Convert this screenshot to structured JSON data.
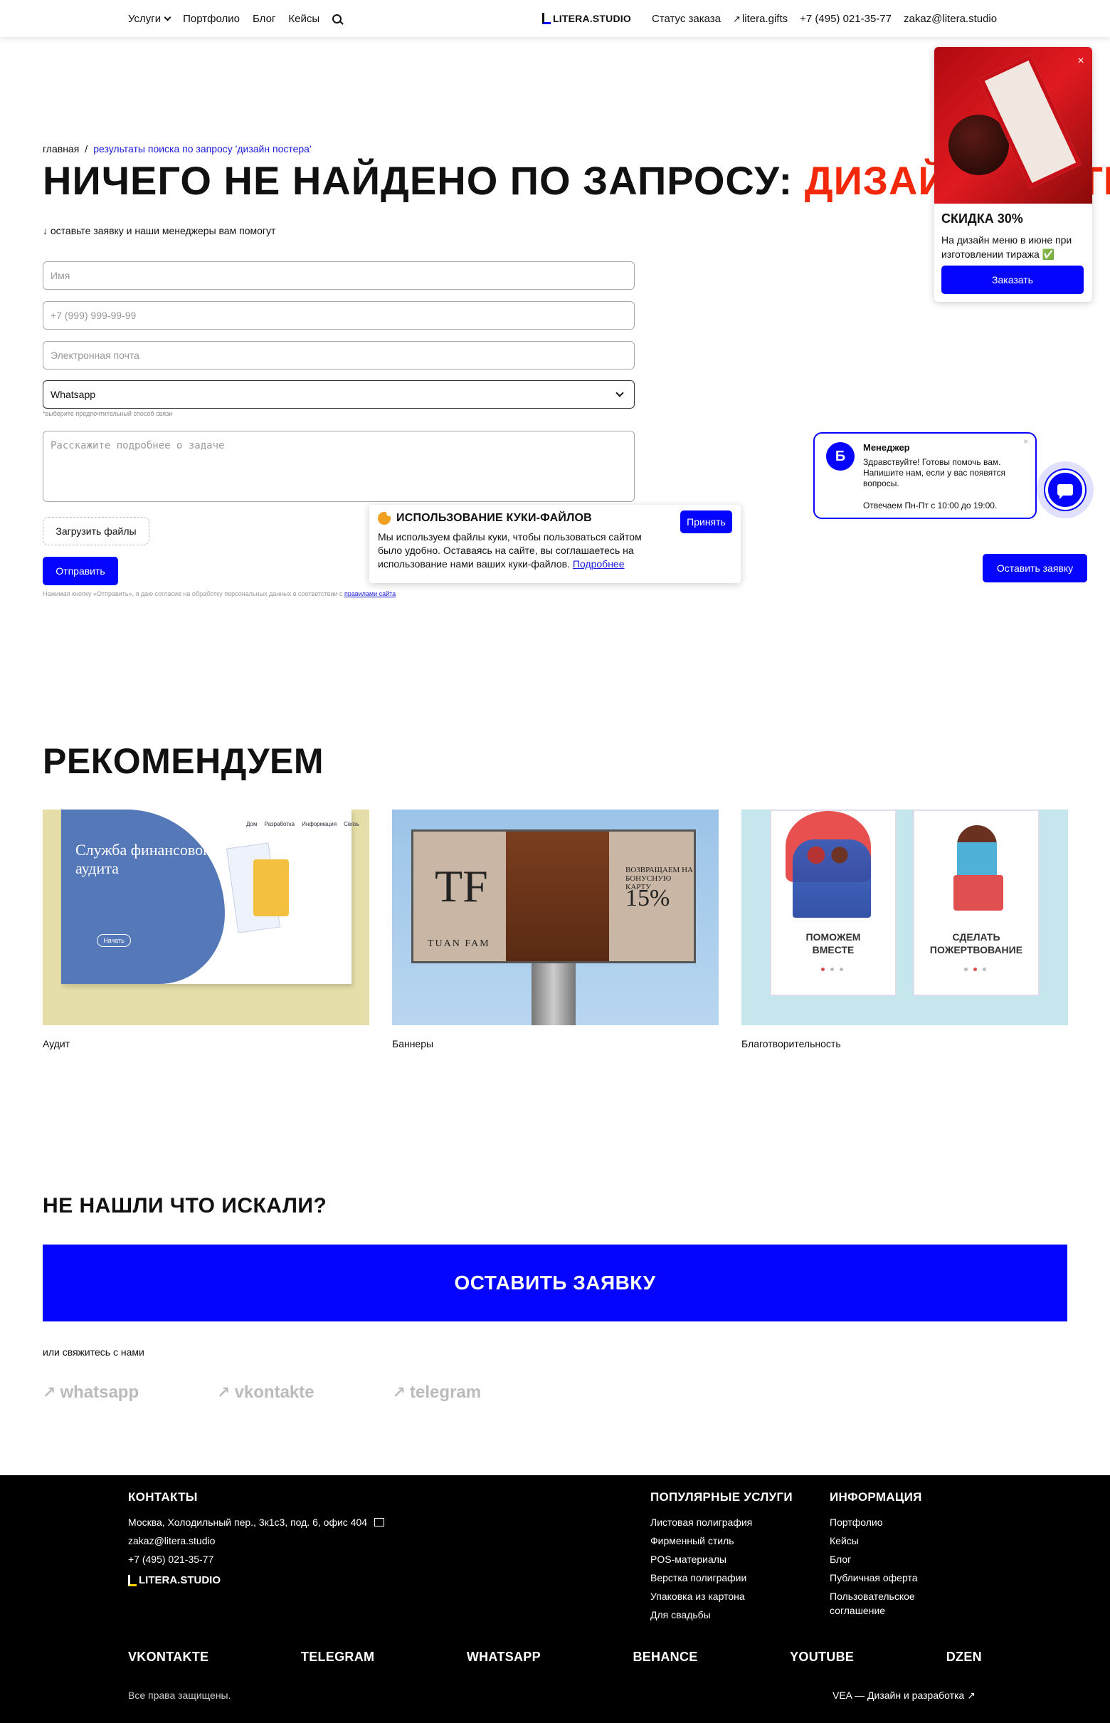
{
  "header": {
    "nav": [
      "Услуги",
      "Портфолио",
      "Блог",
      "Кейсы"
    ],
    "logo": "LITERA.STUDIO",
    "order_status": "Статус заказа",
    "gifts": "litera.gifts",
    "phone": "+7 (495) 021-35-77",
    "email": "zakaz@litera.studio"
  },
  "breadcrumb": {
    "home": "главная",
    "sep": "/",
    "current": "результаты поиска по запросу 'дизайн постера'"
  },
  "title": {
    "prefix": "НИЧЕГО НЕ НАЙДЕНО ПО ЗАПРОСУ:",
    "query": "ДИЗАЙН ПОСТЕРА"
  },
  "hint": "↓ оставьте заявку и наши менеджеры вам помогут",
  "form": {
    "name_placeholder": "Имя",
    "phone_placeholder": "+7 (999) 999-99-99",
    "email_placeholder": "Электронная почта",
    "contact_method": "Whatsapp",
    "contact_note": "*выберите предпочтительный способ связи",
    "message_placeholder": "Расскажите подробнее о задаче",
    "upload_label": "Загрузить файлы",
    "submit_label": "Отправить",
    "consent_text": "Нажимая кнопку «Отправить», я даю согласие на обработку персональных данных в соответствии с",
    "consent_link": "правилами сайта"
  },
  "cookie": {
    "title": "ИСПОЛЬЗОВАНИЕ КУКИ-ФАЙЛОВ",
    "text": "Мы используем файлы куки, чтобы пользоваться сайтом было удобно. Оставаясь на сайте, вы соглашаетесь на использование нами ваших куки-файлов.",
    "more": "Подробнее",
    "accept": "Принять"
  },
  "promo": {
    "title": "СКИДКА 30%",
    "text": "На дизайн меню в июне при изготовлении тиража ✅",
    "button": "Заказать",
    "close": "×"
  },
  "manager": {
    "name": "Менеджер",
    "message": "Здравствуйте! Готовы помочь вам. Напишите нам, если у вас появятся вопросы.",
    "hours": "Отвечаем Пн-Пт с 10:00 до 19:00.",
    "close": "×"
  },
  "leave_request": "Оставить заявку",
  "recommend": {
    "title": "РЕКОМЕНДУЕМ",
    "cards": [
      {
        "caption": "Аудит",
        "image_text": "Служба финансового аудита",
        "start": "Начать",
        "menu": [
          "Дом",
          "Разработка",
          "Информация",
          "Связь"
        ]
      },
      {
        "caption": "Баннеры",
        "logo": "TF",
        "brand": "TUAN FAM",
        "top": "ВОЗВРАЩАЕМ НА БОНУСНУЮ КАРТУ",
        "percent": "15%"
      },
      {
        "caption": "Благотворительность",
        "panel1": "ПОМОЖЕМ ВМЕСТЕ",
        "panel2": "СДЕЛАТЬ ПОЖЕРТВОВАНИЕ"
      }
    ]
  },
  "not_found": {
    "title": "НЕ НАШЛИ ЧТО ИСКАЛИ?",
    "button": "ОСТАВИТЬ ЗАЯВКУ",
    "contact_line": "или свяжитесь с нами",
    "socials": [
      "whatsapp",
      "vkontakte",
      "telegram"
    ]
  },
  "footer": {
    "contacts_title": "КОНТАКТЫ",
    "address": "Москва, Холодильный пер., 3к1с3, под. 6, офис 404",
    "email": "zakaz@litera.studio",
    "phone": "+7 (495) 021-35-77",
    "logo": "LITERA.STUDIO",
    "services_title": "ПОПУЛЯРНЫЕ УСЛУГИ",
    "services": [
      "Листовая полиграфия",
      "Фирменный стиль",
      "POS-материалы",
      "Верстка полиграфии",
      "Упаковка из картона",
      "Для свадьбы"
    ],
    "info_title": "ИНФОРМАЦИЯ",
    "info": [
      "Портфолио",
      "Кейсы",
      "Блог",
      "Публичная оферта",
      "Пользовательское соглашение"
    ],
    "socials": [
      "VKONTAKTE",
      "TELEGRAM",
      "WHATSAPP",
      "BEHANCE",
      "YOUTUBE",
      "DZEN"
    ],
    "rights": "Все права защищены.",
    "credit": "VEA — Дизайн и разработка ↗"
  }
}
